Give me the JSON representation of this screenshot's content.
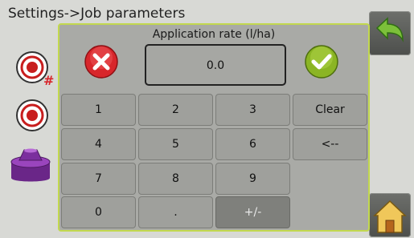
{
  "header": {
    "title": "Settings->Job parameters"
  },
  "sidebar": {
    "icons": [
      "target-rate-icon",
      "target-icon",
      "nozzle-icon"
    ]
  },
  "nav": {
    "back_icon": "back-arrow-icon",
    "home_icon": "home-icon"
  },
  "dialog": {
    "title": "Application rate (l/ha)",
    "value": "0.0",
    "cancel_icon": "close-x-icon",
    "confirm_icon": "checkmark-icon",
    "keys": {
      "k1": "1",
      "k2": "2",
      "k3": "3",
      "clear": "Clear",
      "k4": "4",
      "k5": "5",
      "k6": "6",
      "backspace": "<--",
      "k7": "7",
      "k8": "8",
      "k9": "9",
      "k0": "0",
      "dot": ".",
      "sign": "+/-"
    }
  },
  "colors": {
    "accent_border": "#c2d84e",
    "cancel_red": "#d8262b",
    "confirm_green": "#8bb524",
    "nozzle_purple": "#7b2f9e"
  }
}
